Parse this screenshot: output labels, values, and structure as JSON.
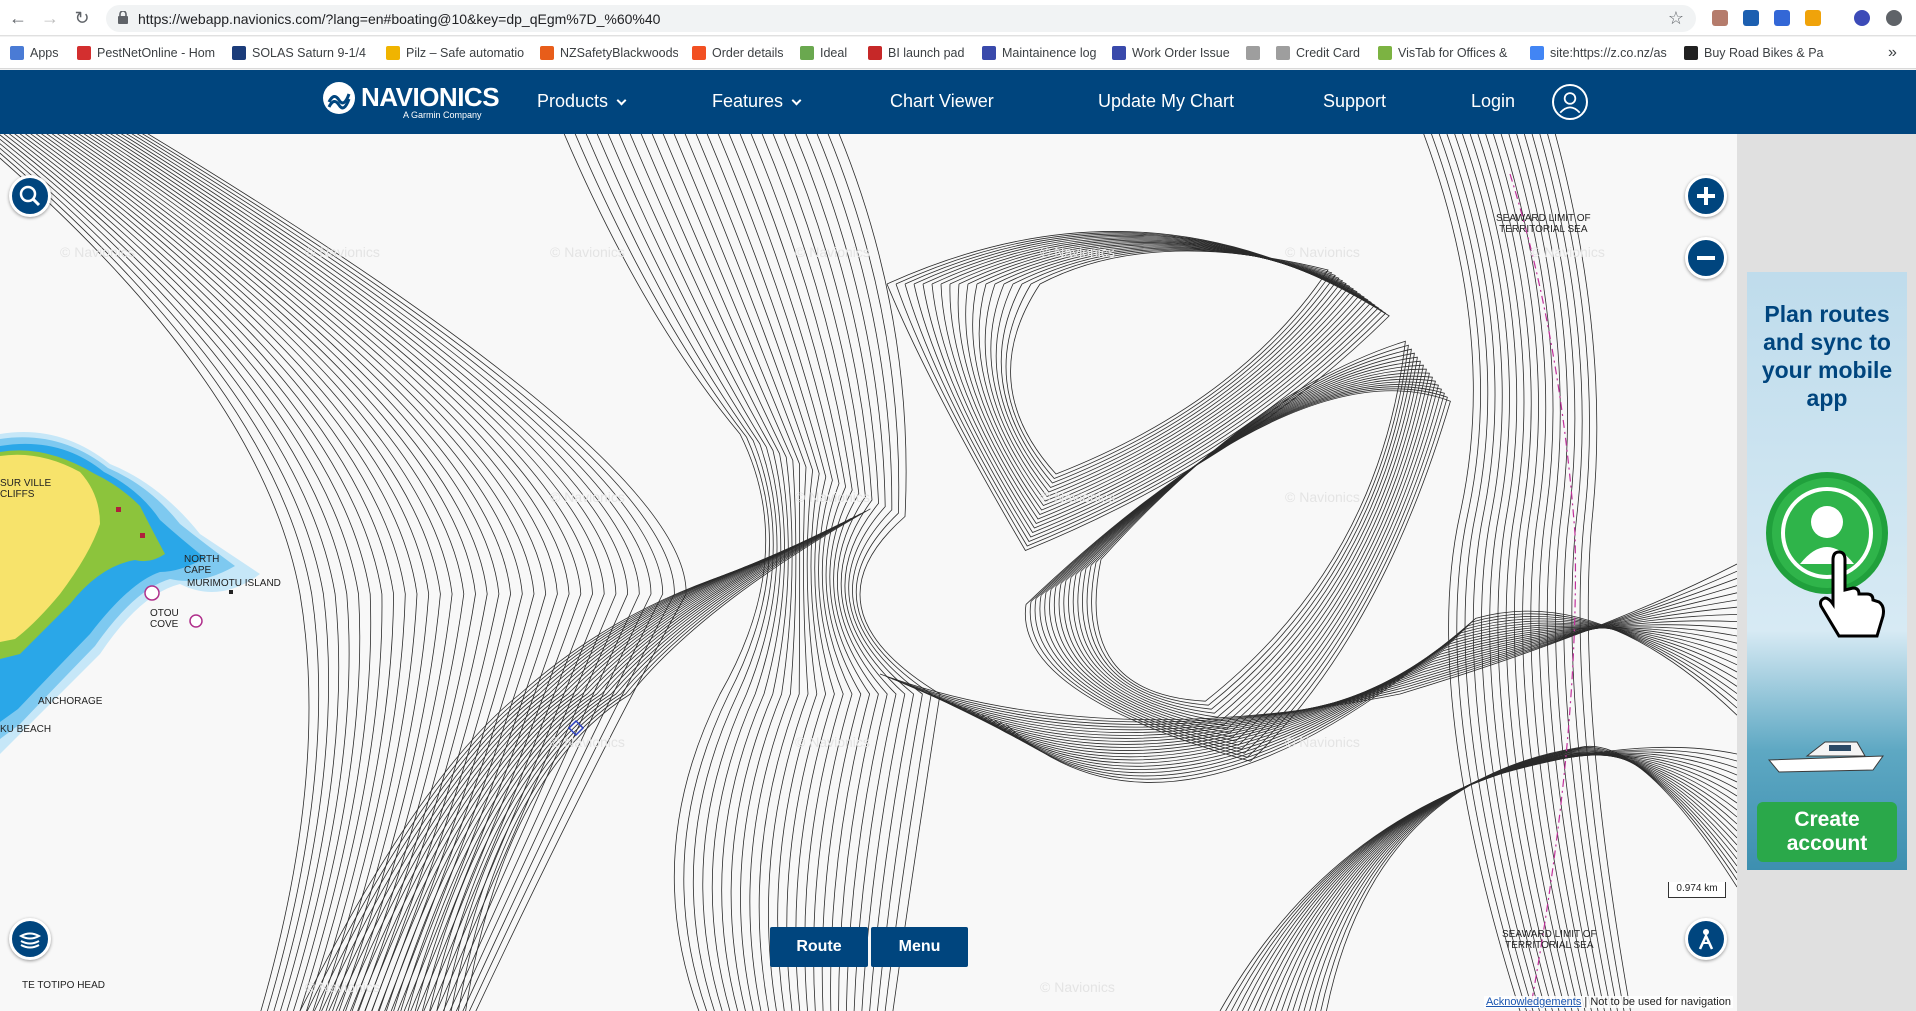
{
  "browser": {
    "url": "https://webapp.navionics.com/?lang=en#boating@10&key=dp_qEgm%7D_%60%40",
    "bookmarks": [
      {
        "label": "Apps",
        "color": "#4a7bd5"
      },
      {
        "label": "PestNetOnline - Hom",
        "color": "#d32f2f"
      },
      {
        "label": "SOLAS Saturn 9-1/4",
        "color": "#1b3c7a"
      },
      {
        "label": "Pilz – Safe automatio",
        "color": "#f0b400"
      },
      {
        "label": "NZSafetyBlackwoods",
        "color": "#e85d1a"
      },
      {
        "label": "Order details",
        "color": "#f25022"
      },
      {
        "label": "Ideal",
        "color": "#6aa84f"
      },
      {
        "label": "BI launch pad",
        "color": "#c62828"
      },
      {
        "label": "Maintainence log",
        "color": "#3949ab"
      },
      {
        "label": "Work Order Issue",
        "color": "#3949ab"
      },
      {
        "label": "",
        "color": "#9e9e9e"
      },
      {
        "label": "Credit Card",
        "color": "#9e9e9e"
      },
      {
        "label": "VisTab for Offices &",
        "color": "#7cb342"
      },
      {
        "label": "site:https://z.co.nz/as",
        "color": "#4285f4"
      },
      {
        "label": "Buy Road Bikes & Pa",
        "color": "#212121"
      }
    ]
  },
  "header": {
    "logo_text": "NAVIONICS",
    "logo_sub": "A Garmin Company",
    "menu": [
      {
        "label": "Products",
        "dropdown": true
      },
      {
        "label": "Features",
        "dropdown": true
      },
      {
        "label": "Chart Viewer",
        "dropdown": false
      },
      {
        "label": "Update My Chart",
        "dropdown": false
      },
      {
        "label": "Support",
        "dropdown": false
      },
      {
        "label": "Login",
        "dropdown": false
      }
    ]
  },
  "map": {
    "labels": {
      "sur_ville_1": "SUR VILLE",
      "sur_ville_2": "CLIFFS",
      "north_cape_1": "NORTH",
      "north_cape_2": "CAPE",
      "murimotu": "MURIMOTU ISLAND",
      "otou_1": "OTOU",
      "otou_2": "COVE",
      "anchorage": "ANCHORAGE",
      "beach": "KU BEACH",
      "te_totipo": "TE TOTIPO HEAD",
      "seaward_top_1": "SEAWARD LIMIT OF",
      "seaward_top_2": "TERRITORIAL SEA",
      "seaward_bot_1": "SEAWARD LIMIT OF",
      "seaward_bot_2": "TERRITORIAL SEA"
    },
    "watermark": "© Navionics",
    "scale": "0.974  km",
    "route_label": "Route",
    "menu_label": "Menu",
    "ack_label": "Acknowledgements",
    "disclaimer": "Not to be used for navigation",
    "colors": {
      "land": "#f7e36b",
      "green": "#8cc43c",
      "shallow": "#2aa7e8",
      "mid": "#7ec9f0",
      "light": "#c6e7f8",
      "contour": "#2b2b2b"
    }
  },
  "ad": {
    "headline": "Plan routes and sync to your mobile app",
    "cta": "Create account"
  }
}
